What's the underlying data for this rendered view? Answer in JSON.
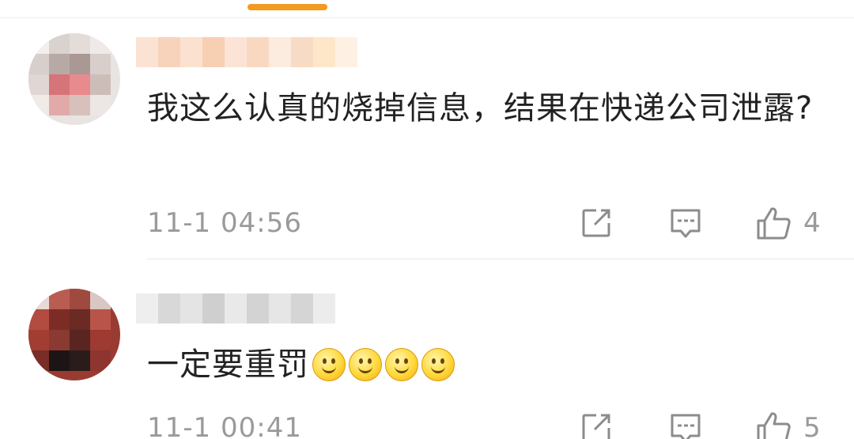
{
  "colors": {
    "accent": "#f39a1f",
    "text": "#222222",
    "meta": "#9a9a9a",
    "icon": "#8c8c8c"
  },
  "comments": [
    {
      "text": "我这么认真的烧掉信息，结果在快递公司泄露?",
      "time": "11-1 04:56",
      "likes": "4",
      "avatar": "blurred-avatar",
      "username": "blurred-username"
    },
    {
      "text": "一定要重罚",
      "emojis": [
        "smile-emoji",
        "smile-emoji",
        "smile-emoji",
        "smile-emoji"
      ],
      "time": "11-1 00:41",
      "likes": "5",
      "avatar": "blurred-avatar",
      "username": "blurred-username"
    }
  ],
  "icons": {
    "forward": "forward-icon",
    "reply": "comment-icon",
    "like": "thumbs-up-icon"
  }
}
